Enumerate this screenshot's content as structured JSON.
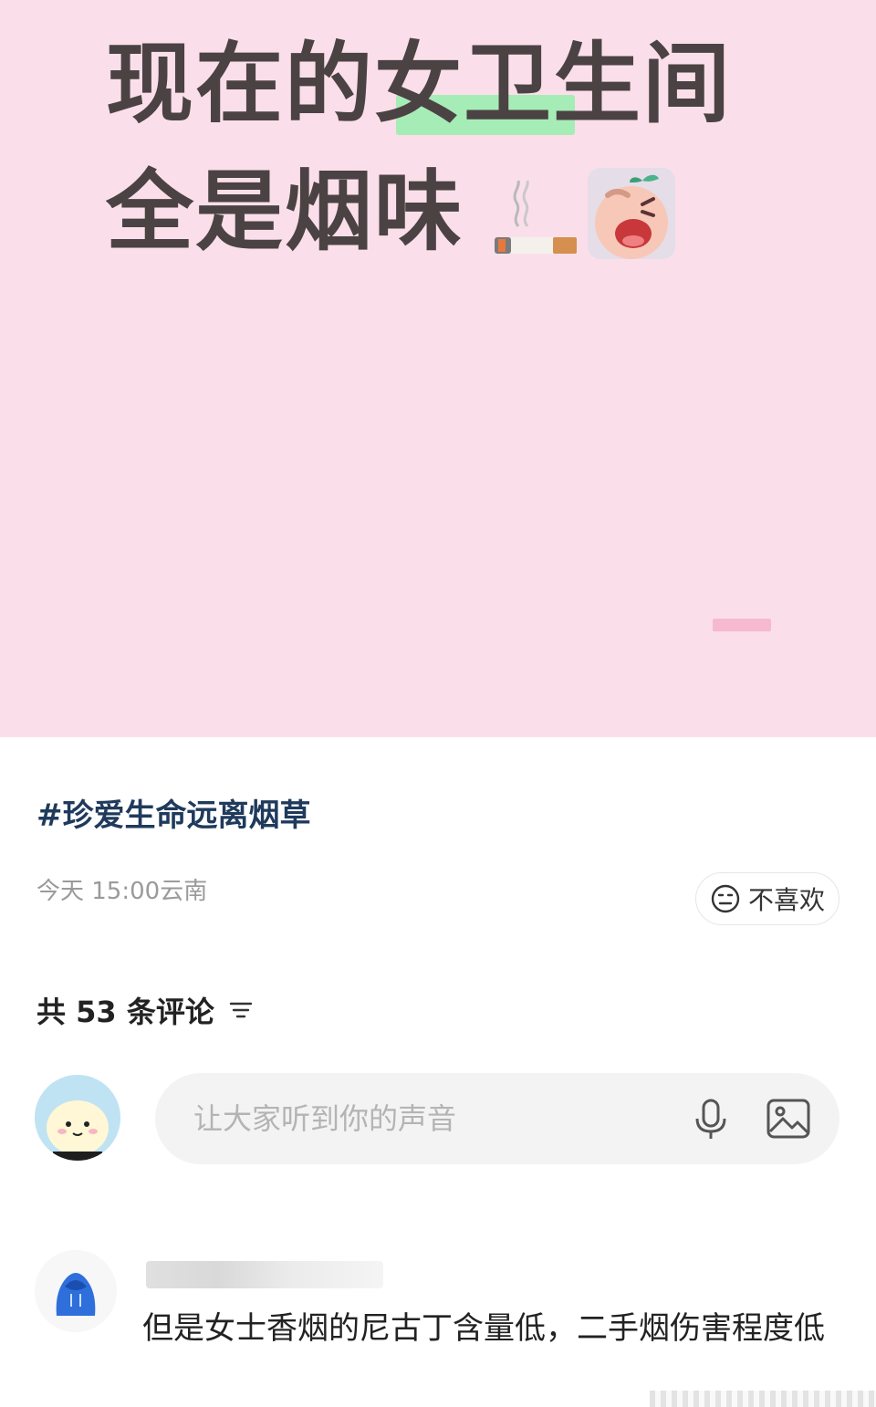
{
  "post": {
    "headline_line1": "现在的女卫生间",
    "headline_line2": "全是烟味",
    "hashtag": "#珍爱生命远离烟草",
    "meta": "今天 15:00云南",
    "dislike_label": "不喜欢"
  },
  "comments": {
    "count_label": "共 53 条评论",
    "input_placeholder": "让大家听到你的声音",
    "items": [
      {
        "text": "但是女士香烟的尼古丁含量低，二手烟伤害程度低"
      }
    ]
  },
  "icons": {
    "cigarette": "cigarette-icon",
    "sticker": "crying-face-sticker",
    "dislike": "neutral-face-icon",
    "sort": "sort-icon",
    "mic": "microphone-icon",
    "image": "image-icon"
  },
  "colors": {
    "hero_bg": "#fadfea",
    "highlight": "#a6ecb6",
    "hashtag": "#1f3a5c",
    "input_bg": "#f3f3f3"
  }
}
